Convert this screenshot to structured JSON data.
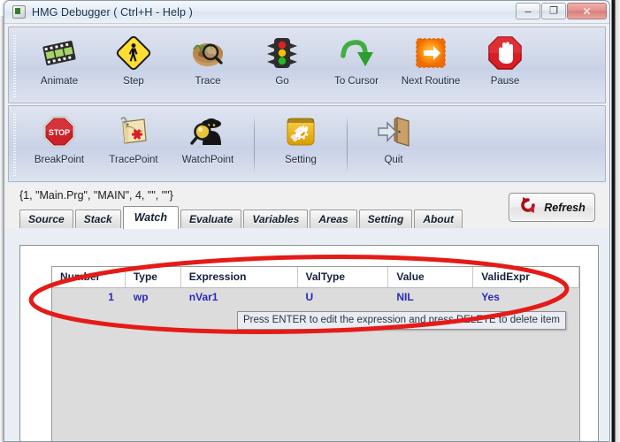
{
  "window": {
    "title": "HMG Debugger  ( Ctrl+H - Help )",
    "app_icon": "app-window-icon",
    "controls": {
      "minimize": "–",
      "maximize": "❐",
      "close": "✕"
    }
  },
  "toolbar_rows": [
    {
      "items": [
        {
          "label": "Animate",
          "icon": "film-strip-icon"
        },
        {
          "label": "Step",
          "icon": "pedestrian-crossing-sign-icon"
        },
        {
          "label": "Trace",
          "icon": "footprints-magnifier-icon"
        },
        {
          "label": "Go",
          "icon": "traffic-light-icon"
        },
        {
          "label": "To Cursor",
          "icon": "green-curved-arrow-icon"
        },
        {
          "label": "Next Routine",
          "icon": "orange-arrow-square-icon"
        },
        {
          "label": "Pause",
          "icon": "red-stop-hand-icon"
        }
      ]
    },
    {
      "items": [
        {
          "label": "BreakPoint",
          "icon": "stop-sign-icon"
        },
        {
          "label": "TracePoint",
          "icon": "map-asterisk-icon"
        },
        {
          "label": "WatchPoint",
          "icon": "spy-magnifier-icon"
        },
        {
          "label": "Setting",
          "icon": "gear-hammer-icon"
        },
        {
          "label": "Quit",
          "icon": "exit-door-icon"
        }
      ]
    }
  ],
  "status_line": "{1, \"Main.Prg\", \"MAIN\", 4, \"\", \"\"}",
  "tabs": [
    {
      "label": "Source",
      "active": false
    },
    {
      "label": "Stack",
      "active": false
    },
    {
      "label": "Watch",
      "active": true
    },
    {
      "label": "Evaluate",
      "active": false
    },
    {
      "label": "Variables",
      "active": false
    },
    {
      "label": "Areas",
      "active": false
    },
    {
      "label": "Setting",
      "active": false
    },
    {
      "label": "About",
      "active": false
    }
  ],
  "refresh": {
    "label": "Refresh",
    "icon": "refresh-circular-arrow-icon"
  },
  "watch_grid": {
    "columns": [
      "Number",
      "Type",
      "Expression",
      "ValType",
      "Value",
      "ValidExpr"
    ],
    "rows": [
      {
        "Number": "1",
        "Type": "wp",
        "Expression": "nVar1",
        "ValType": "U",
        "Value": "NIL",
        "ValidExpr": "Yes"
      }
    ]
  },
  "tooltip": {
    "text": "Press ENTER to edit the expression and press DELETE to delete item"
  },
  "annotation": {
    "shape": "ellipse",
    "color": "#e41b17"
  },
  "colors": {
    "title_text": "#11304e",
    "toolbar_bg": "#ced6e8",
    "grid_value_text": "#2a2ab8",
    "annotation_red": "#e41b17",
    "close_button": "#d57f79"
  }
}
